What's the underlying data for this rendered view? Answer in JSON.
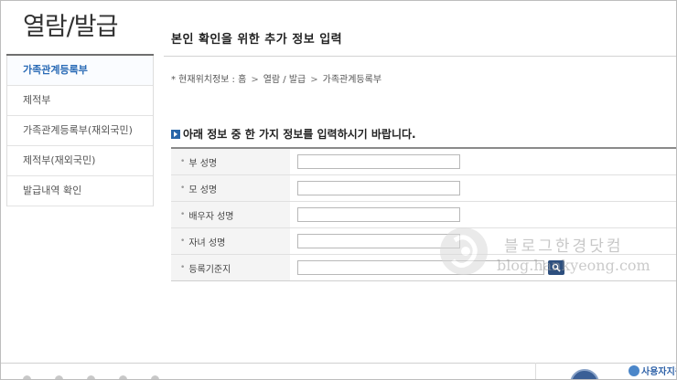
{
  "sidebar": {
    "title": "열람/발급",
    "items": [
      {
        "label": "가족관계등록부",
        "active": true
      },
      {
        "label": "제적부",
        "active": false
      },
      {
        "label": "가족관계등록부(재외국민)",
        "active": false
      },
      {
        "label": "제적부(재외국민)",
        "active": false
      },
      {
        "label": "발급내역 확인",
        "active": false
      }
    ]
  },
  "main": {
    "title": "본인 확인을 위한 추가 정보 입력",
    "breadcrumb": {
      "prefix": "* 현재위치정보 : ",
      "items": [
        "홈",
        "열람 / 발급",
        "가족관계등록부"
      ],
      "separator": ">"
    },
    "section_heading": "아래 정보 중 한 가지 정보를 입력하시기 바랍니다.",
    "form": {
      "bullet": "•",
      "rows": [
        {
          "label": "부 성명",
          "value": "",
          "placeholder": ""
        },
        {
          "label": "모 성명",
          "value": "",
          "placeholder": ""
        },
        {
          "label": "배우자 성명",
          "value": "",
          "placeholder": ""
        },
        {
          "label": "자녀 성명",
          "value": "",
          "placeholder": ""
        },
        {
          "label": "등록기준지",
          "value": "",
          "placeholder": "",
          "has_search": true
        }
      ]
    }
  },
  "watermark": {
    "text": "블로그한경닷컴",
    "sub": "blog.hankyeong.com"
  },
  "footer": {
    "help_label": "사용자지원"
  },
  "colors": {
    "accent": "#2a6bb6",
    "heading_bullet": "#2765a8",
    "search_button": "#2d4f7e",
    "label_bg": "#f4f4f4"
  },
  "icons": {
    "heading": "arrow-right-icon",
    "search": "search-icon"
  }
}
